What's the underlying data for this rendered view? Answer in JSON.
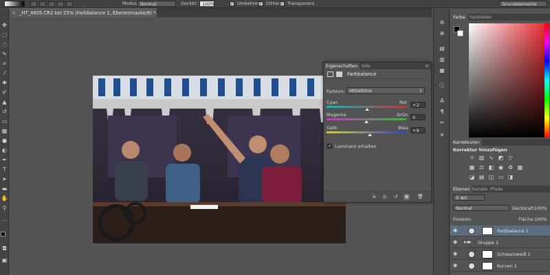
{
  "options_bar": {
    "mode_label": "Modus:",
    "mode_value": "Normal",
    "opacity_label": "Deckkr.:",
    "opacity_value": "100%",
    "reverse_label": "Umkehren",
    "dither_label": "Dither",
    "transparency_label": "Transparenz",
    "workspace_value": "Grundelemente"
  },
  "document": {
    "tab_title": "_HT_4605.CR2 bei 25% (Farbbalance 1, Ebenenmaske/8) *",
    "close_glyph": "×"
  },
  "properties": {
    "tabs": [
      "Eigenschaften",
      "Info"
    ],
    "title": "Farbbalance",
    "tone_label": "Farbton:",
    "tone_value": "Mitteltöne",
    "sliders": [
      {
        "left": "Cyan",
        "right": "Rot",
        "value": "+2",
        "position": 0.51
      },
      {
        "left": "Magenta",
        "right": "Grün",
        "value": "0",
        "position": 0.5
      },
      {
        "left": "Gelb",
        "right": "Blau",
        "value": "+9",
        "position": 0.54
      }
    ],
    "luminance_label": "Luminanz erhalten",
    "luminance_checked": true
  },
  "color_panel": {
    "tabs": [
      "Farbe",
      "Farbfelder"
    ],
    "foreground": "#000000",
    "background": "#ffffff"
  },
  "adjustments_panel": {
    "tab": "Korrekturen",
    "subtitle": "Korrektur hinzufügen"
  },
  "layers_panel": {
    "tabs": [
      "Ebenen",
      "Kanäle",
      "Pfade"
    ],
    "filter_value": "Art",
    "blend_mode": "Normal",
    "opacity_label": "Deckkraft:",
    "opacity_value": "100%",
    "lock_label": "Fixieren:",
    "fill_label": "Fläche:",
    "fill_value": "100%",
    "layers": [
      {
        "name": "Farbbalance 1",
        "selected": true,
        "type": "adjustment"
      },
      {
        "name": "Gruppe 1",
        "selected": false,
        "type": "group"
      },
      {
        "name": "Schwarzweiß 1",
        "selected": false,
        "type": "adjustment"
      },
      {
        "name": "Kurven 1",
        "selected": false,
        "type": "adjustment"
      }
    ]
  },
  "colors": {
    "accent_selected": "#5c6d80",
    "slider_thumb": "#e8e8e8"
  }
}
